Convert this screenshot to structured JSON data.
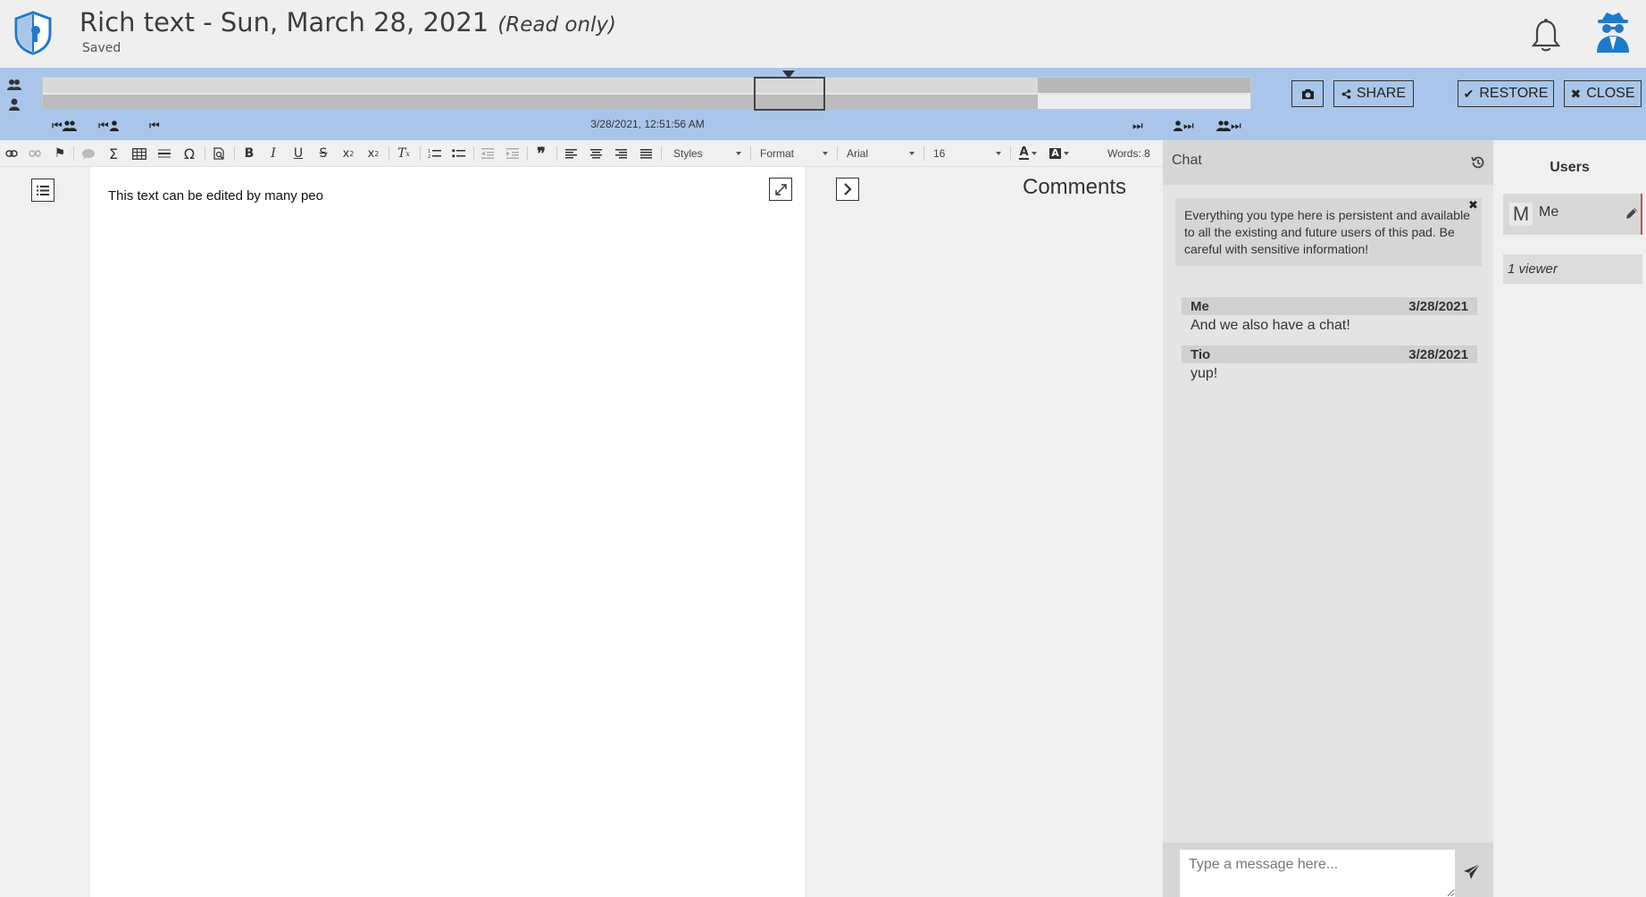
{
  "header": {
    "title": "Rich text - Sun, March 28, 2021",
    "read_only": "(Read only)",
    "status": "Saved"
  },
  "history": {
    "timestamp": "3/28/2021, 12:51:56 AM",
    "buttons": {
      "share": "SHARE",
      "restore": "RESTORE",
      "close": "CLOSE"
    }
  },
  "toolbar": {
    "styles": "Styles",
    "format": "Format",
    "font": "Arial",
    "size": "16",
    "words": "Words: 8"
  },
  "editor": {
    "content": "This text can be edited by many peo"
  },
  "comments": {
    "title": "Comments"
  },
  "chat": {
    "title": "Chat",
    "warning": "Everything you type here is persistent and available to all the existing and future users of this pad. Be careful with sensitive information!",
    "messages": [
      {
        "author": "Me",
        "date": "3/28/2021",
        "text": "And we also have a chat!"
      },
      {
        "author": "Tio",
        "date": "3/28/2021",
        "text": "yup!"
      }
    ],
    "input_placeholder": "Type a message here..."
  },
  "users": {
    "title": "Users",
    "list": [
      {
        "initial": "M",
        "name": "Me"
      }
    ],
    "viewers": "1 viewer"
  },
  "colors": {
    "history_bar": "#a9c6ea",
    "brand_blue": "#1f7acc",
    "user_accent": "#c0504d"
  }
}
